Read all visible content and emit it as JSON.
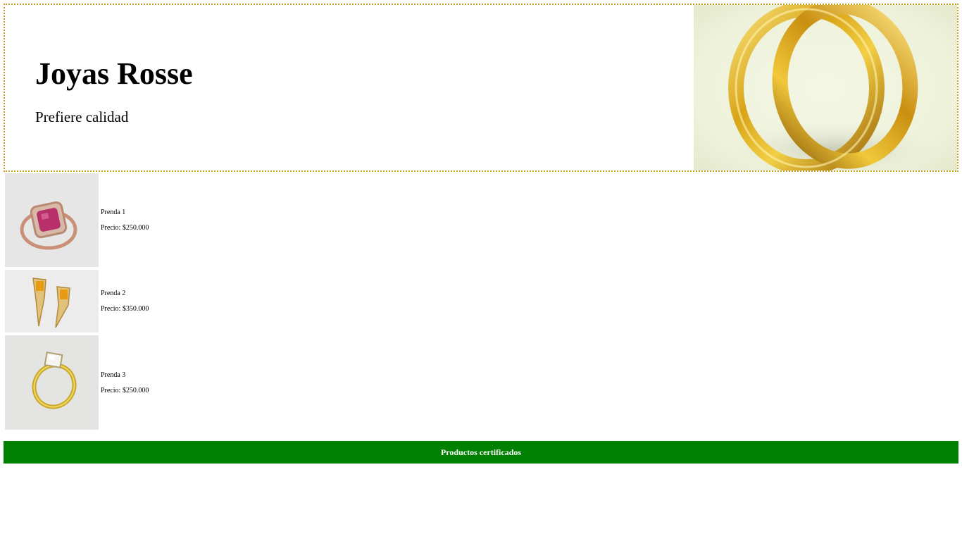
{
  "header": {
    "title": "Joyas Rosse",
    "subtitle": "Prefiere calidad",
    "border_color": "#c8a020"
  },
  "products": [
    {
      "name": "Prenda 1",
      "price": "Precio: $250.000",
      "image": "pink-gem-ring"
    },
    {
      "name": "Prenda 2",
      "price": "Precio: $350.000",
      "image": "gold-earrings"
    },
    {
      "name": "Prenda 3",
      "price": "Precio: $250.000",
      "image": "diamond-solitaire-ring"
    }
  ],
  "footer": {
    "text": "Productos certificados",
    "background": "#008000"
  }
}
